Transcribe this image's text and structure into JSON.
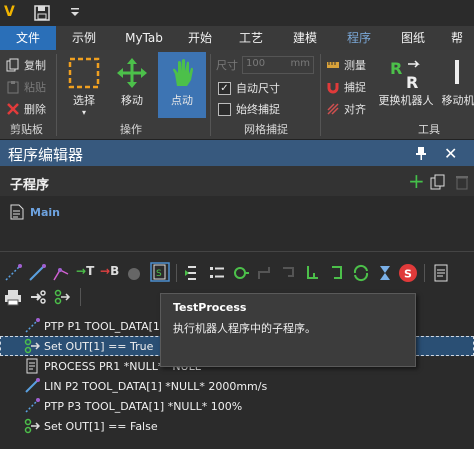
{
  "quick_access": {
    "logo": "V"
  },
  "tabs": [
    {
      "label": "文件",
      "active": true
    },
    {
      "label": "示例"
    },
    {
      "label": "MyTab"
    },
    {
      "label": "开始"
    },
    {
      "label": "工艺"
    },
    {
      "label": "建模"
    },
    {
      "label": "程序",
      "dim": true
    },
    {
      "label": "图纸"
    },
    {
      "label": "帮"
    }
  ],
  "ribbon": {
    "clipboard": {
      "copy": "复制",
      "paste": "粘贴",
      "delete": "删除",
      "group": "剪贴板"
    },
    "operate": {
      "select": "选择",
      "move": "移动",
      "point": "点动",
      "group": "操作"
    },
    "grid": {
      "size_label": "尺寸",
      "size_value": "100",
      "size_unit": "mm",
      "auto_size": "自动尺寸",
      "always_snap": "始终捕捉",
      "group": "网格捕捉"
    },
    "tools": {
      "measure": "测量",
      "snap": "捕捉",
      "align": "对齐",
      "replace_robot": "更换机器人",
      "move_robot": "移动机",
      "group": "工具"
    }
  },
  "panel": {
    "title": "程序编辑器"
  },
  "subprograms": {
    "header": "子程序",
    "items": [
      "Main"
    ]
  },
  "tooltip": {
    "title": "TestProcess",
    "description": "执行机器人程序中的子程序。"
  },
  "program": {
    "rows": [
      {
        "text": "PTP P1 TOOL_DATA[1]",
        "icon": "ptp-icon"
      },
      {
        "text": "Set OUT[1] == True",
        "icon": "set-output-icon",
        "selected": true
      },
      {
        "text": "PROCESS PR1 *NULL* *NULL*",
        "icon": "process-icon"
      },
      {
        "text": "LIN P2 TOOL_DATA[1] *NULL* 2000mm/s",
        "icon": "lin-icon"
      },
      {
        "text": "PTP P3 TOOL_DATA[1] *NULL* 100%",
        "icon": "ptp-icon"
      },
      {
        "text": "Set OUT[1] == False",
        "icon": "set-output-icon"
      }
    ]
  },
  "colors": {
    "accent": "#2a6fb8",
    "panel_title": "#37597e",
    "selection": "#2a4f74"
  }
}
